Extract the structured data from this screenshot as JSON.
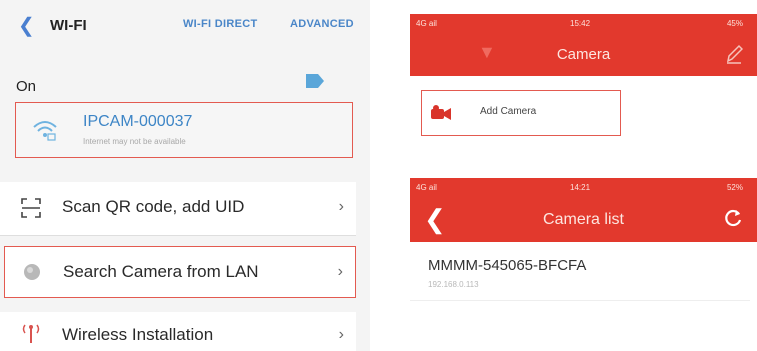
{
  "wifi_screen": {
    "title": "WI-FI",
    "links": [
      "WI-FI DIRECT",
      "ADVANCED"
    ],
    "status_label": "On",
    "network": {
      "name": "IPCAM-000037",
      "subtitle": "Internet may not be available"
    },
    "menu": [
      {
        "label": "Scan QR code, add UID",
        "icon": "qr-scan-icon"
      },
      {
        "label": "Search Camera from LAN",
        "icon": "lan-search-icon"
      },
      {
        "label": "Wireless Installation",
        "icon": "antenna-icon"
      }
    ],
    "colors": {
      "accent": "#4a86c8",
      "highlight_border": "#e35a50"
    }
  },
  "camera_screen": {
    "status_bar": {
      "signal": "4G ail",
      "time": "15:42",
      "battery": "45%"
    },
    "title": "Camera",
    "add_camera_label": "Add Camera",
    "colors": {
      "header": "#e2392d"
    }
  },
  "camera_list_screen": {
    "status_bar": {
      "signal": "4G ail",
      "time": "14:21",
      "battery": "52%"
    },
    "title": "Camera list",
    "camera": {
      "name": "MMMM-545065-BFCFA",
      "ip": "192.168.0.113"
    }
  }
}
